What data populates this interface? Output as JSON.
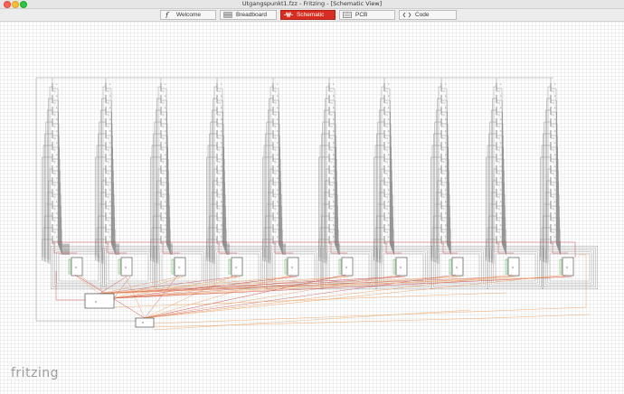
{
  "window": {
    "title": "Utgangspunkt1.fzz - Fritzing - [Schematic View]"
  },
  "tabs": [
    {
      "label": "Welcome",
      "icon": "fritzing-f-icon",
      "active": false
    },
    {
      "label": "Breadboard",
      "icon": "breadboard-icon",
      "active": false
    },
    {
      "label": "Schematic",
      "icon": "schematic-wave-icon",
      "active": true
    },
    {
      "label": "PCB",
      "icon": "pcb-icon",
      "active": false
    },
    {
      "label": "Code",
      "icon": "code-brackets-icon",
      "active": false
    }
  ],
  "logo": {
    "text": "fritzing"
  },
  "colors": {
    "accent": "#d62d20",
    "wire_gray": "#8a8a8a",
    "wire_orange": "#f0a060",
    "wire_red": "#d04040",
    "part_green": "#6abf6a"
  }
}
